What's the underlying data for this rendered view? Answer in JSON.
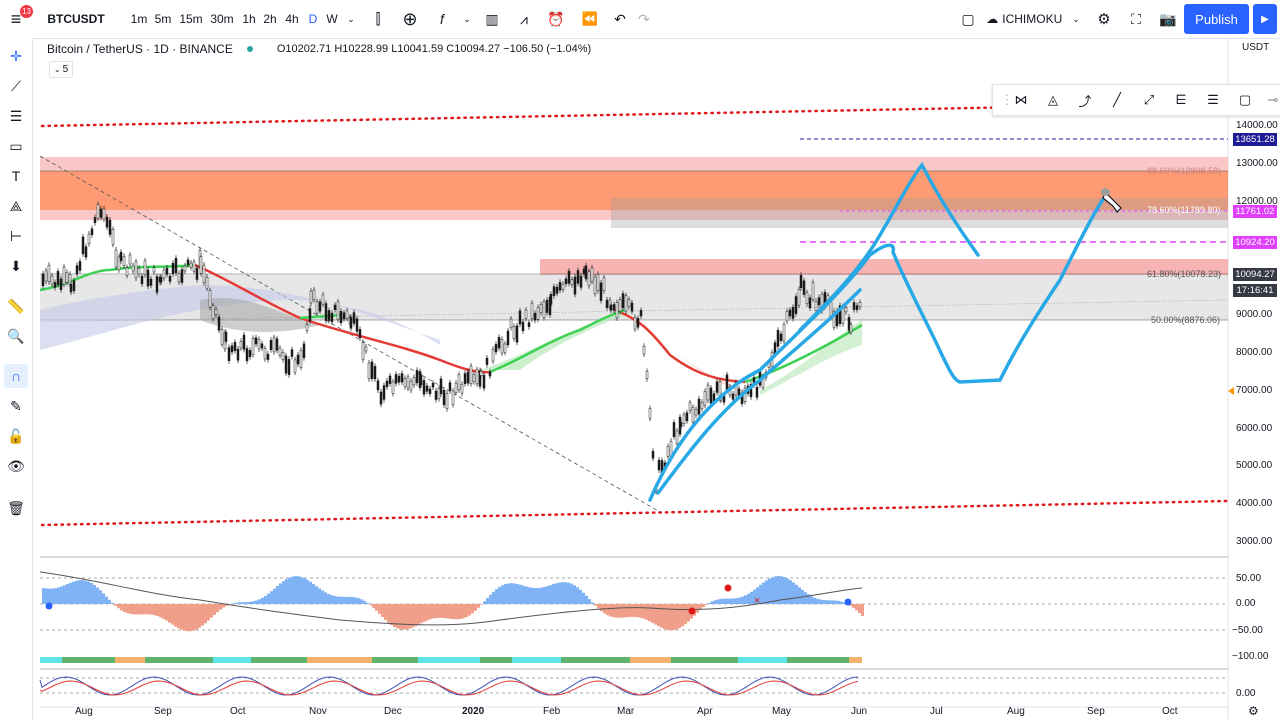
{
  "topbar": {
    "menu_badge": "13",
    "symbol": "BTCUSDT",
    "intervals": [
      "1m",
      "5m",
      "15m",
      "30m",
      "1h",
      "2h",
      "4h",
      "D",
      "W"
    ],
    "active_interval": "D",
    "indicator_template": "ICHIMOKU",
    "publish_label": "Publish"
  },
  "legend": {
    "title": "Bitcoin / TetherUS · 1D · BINANCE",
    "ohlc": "O10202.71  H10228.99  L10041.59  C10094.27  −106.50 (−1.04%)",
    "indicators_count": "5"
  },
  "price_axis": {
    "currency": "USDT",
    "ticks": [
      "14000.00",
      "13000.00",
      "12000.00",
      "9000.00",
      "8000.00",
      "7000.00",
      "6000.00",
      "5000.00",
      "4000.00",
      "3000.00"
    ],
    "tags": [
      {
        "value": "13651.28",
        "color": "#1e1b96"
      },
      {
        "value": "11761.02",
        "color": "#e040fb"
      },
      {
        "value": "10924.20",
        "color": "#e040fb"
      },
      {
        "value": "10094.27",
        "color": "#363a45"
      },
      {
        "value": "17:16:41",
        "color": "#363a45"
      }
    ]
  },
  "fib_labels": [
    "88.60%(12808.58)",
    "78.60%(11789.80)",
    "61.80%(10078.23)",
    "50.00%(8876.06)"
  ],
  "oscillator_axis": [
    "50.00",
    "0.00",
    "−50.00",
    "−100.00",
    "0.00"
  ],
  "time_axis": [
    "Aug",
    "Sep",
    "Oct",
    "Nov",
    "Dec",
    "2020",
    "Feb",
    "Mar",
    "Apr",
    "May",
    "Jun",
    "Jul",
    "Aug",
    "Sep",
    "Oct"
  ],
  "colors": {
    "accent": "#2962ff",
    "drawing": "#29a8e6",
    "ma_red": "#e53935",
    "ma_green": "#3cd154",
    "fib_zone": "#ff7f50",
    "red_dotted": "#e0181b"
  }
}
